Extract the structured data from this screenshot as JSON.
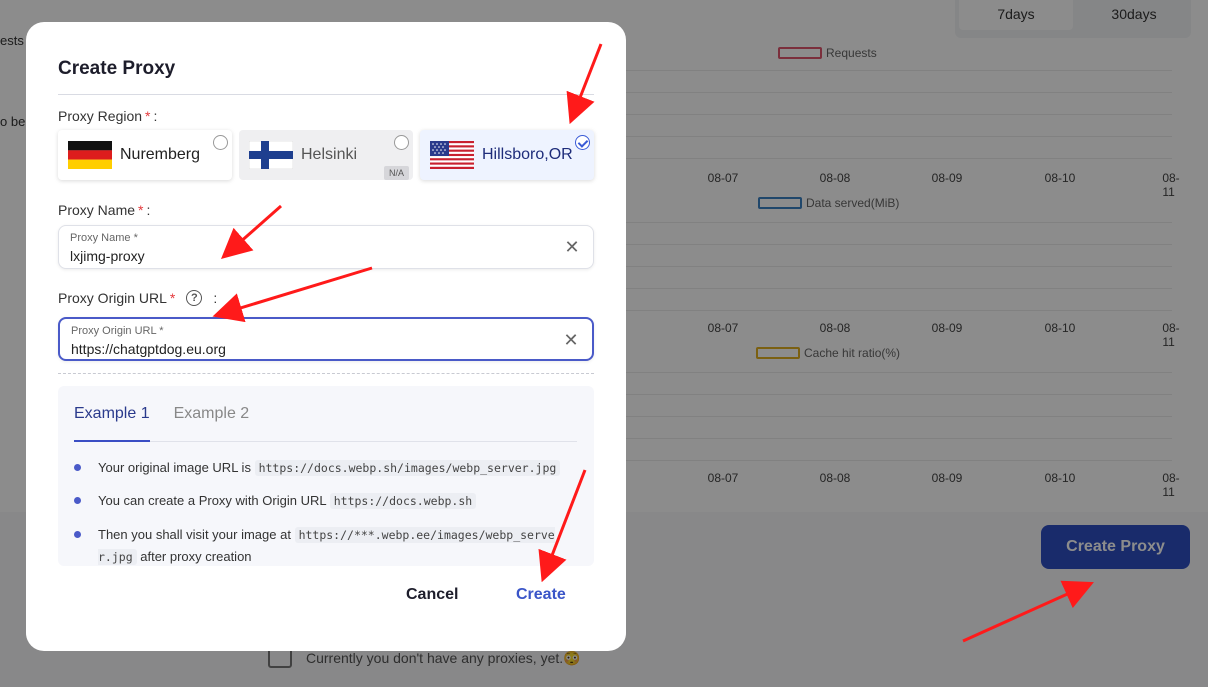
{
  "background": {
    "range_tabs": [
      "7days",
      "30days"
    ],
    "left_fragments": [
      "ests",
      "o be"
    ],
    "charts": [
      {
        "legend": "Requests",
        "legend_color": "#e0566d",
        "ticks": [
          "08-07",
          "08-08",
          "08-09",
          "08-10",
          "08-11"
        ]
      },
      {
        "legend": "Data served(MiB)",
        "legend_color": "#3b82c4",
        "ticks": [
          "08-07",
          "08-08",
          "08-09",
          "08-10",
          "08-11"
        ]
      },
      {
        "legend": "Cache hit ratio(%)",
        "legend_color": "#e0b020",
        "ticks": [
          "08-07",
          "08-08",
          "08-09",
          "08-10",
          "08-11"
        ]
      }
    ],
    "create_button": "Create Proxy",
    "empty_message": "Currently you don't have any proxies, yet.😳"
  },
  "modal": {
    "title": "Create Proxy",
    "region_label": "Proxy Region",
    "name_label": "Proxy Name",
    "origin_label": "Proxy Origin URL",
    "label_suffix": " :",
    "required_mark": "*",
    "help_icon": "?",
    "regions": [
      {
        "name": "Nuremberg",
        "flag": "germany-flag",
        "state": "available"
      },
      {
        "name": "Helsinki",
        "flag": "finland-flag",
        "state": "disabled",
        "badge": "N/A"
      },
      {
        "name": "Hillsboro,OR",
        "flag": "usa-flag",
        "state": "selected"
      }
    ],
    "name_input": {
      "float_label": "Proxy Name *",
      "value": "lxjimg-proxy"
    },
    "origin_input": {
      "float_label": "Proxy Origin URL *",
      "value": "https://chatgptdog.eu.org"
    },
    "clear_glyph": "✕",
    "examples": {
      "tabs": [
        "Example 1",
        "Example 2"
      ],
      "active_tab": "Example 1",
      "items": [
        {
          "text": "Your original image URL is",
          "code": "https://docs.webp.sh/images/webp_server.jpg",
          "after": ""
        },
        {
          "text": "You can create a Proxy with Origin URL",
          "code": "https://docs.webp.sh",
          "after": ""
        },
        {
          "text": "Then you shall visit your image at",
          "code": "https://***.webp.ee/images/webp_server.jpg",
          "after": "after proxy creation"
        }
      ]
    },
    "cancel_label": "Cancel",
    "create_label": "Create"
  },
  "colors": {
    "primary": "#3a55c8",
    "required": "#e4393c",
    "annotation_arrow": "#ff1a1a"
  }
}
